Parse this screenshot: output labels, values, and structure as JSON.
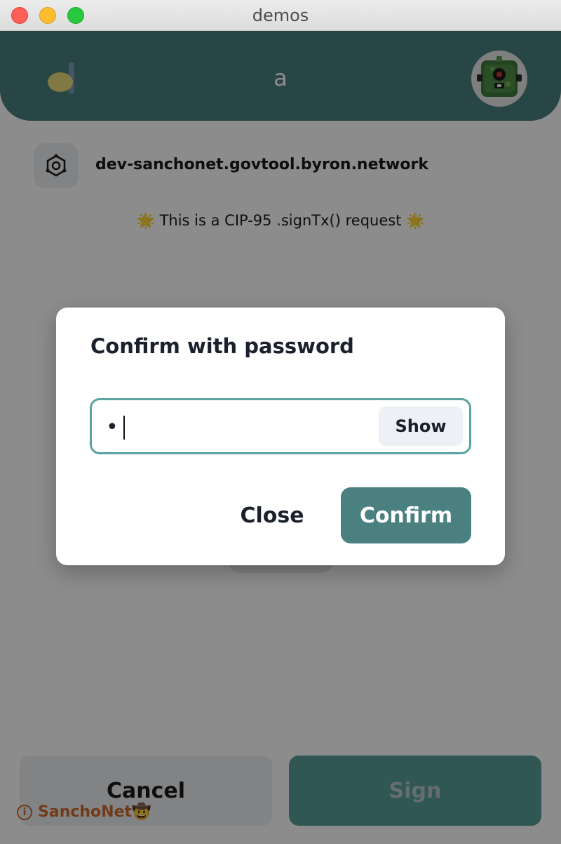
{
  "window": {
    "title": "demos"
  },
  "header": {
    "letter": "a"
  },
  "site": {
    "url": "dev-sanchonet.govtool.byron.network"
  },
  "request": {
    "text": "🌟 This is a CIP-95 .signTx() request 🌟"
  },
  "footer": {
    "cancel_label": "Cancel",
    "sign_label": "Sign",
    "network_label": "SanchoNet🤠",
    "info_icon_glyph": "i"
  },
  "modal": {
    "title": "Confirm with password",
    "password_value": "•",
    "show_label": "Show",
    "close_label": "Close",
    "confirm_label": "Confirm"
  },
  "colors": {
    "accent": "#4a8080",
    "focus_border": "#5aa39f",
    "network": "#d06b2d"
  }
}
